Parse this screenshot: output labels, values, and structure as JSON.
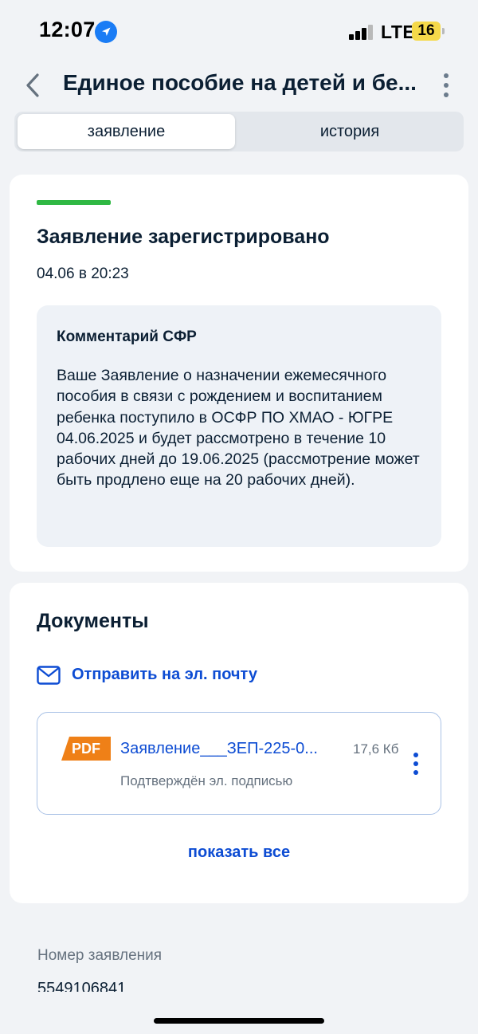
{
  "status_bar": {
    "time": "12:07",
    "network": "LTE",
    "battery": "16",
    "icons": [
      "location-arrow-icon",
      "signal-icon",
      "battery-icon"
    ]
  },
  "header": {
    "title": "Единое пособие на детей и бе...",
    "icons": [
      "chevron-left-icon",
      "more-vertical-icon"
    ]
  },
  "tabs": [
    {
      "label": "заявление",
      "active": true
    },
    {
      "label": "история",
      "active": false
    }
  ],
  "status_card": {
    "title": "Заявление зарегистрировано",
    "date": "04.06 в 20:23",
    "progress_color": "#2fb843",
    "comment": {
      "title": "Комментарий СФР",
      "text": "Ваше Заявление о назначении ежемесячного пособия в связи с рождением и воспитанием ребенка поступило в ОСФР ПО ХМАО - ЮГРЕ 04.06.2025 и будет рассмотрено в течение 10 рабочих дней до 19.06.2025 (рассмотрение может быть продлено еще на 20 рабочих дней)."
    }
  },
  "documents": {
    "title": "Документы",
    "send_email_label": "Отправить на эл. почту",
    "items": [
      {
        "badge": "PDF",
        "name": "Заявление___ЗЕП-225-0...",
        "size": "17,6 Кб",
        "signature": "Подтверждён эл. подписью"
      }
    ],
    "show_all_label": "показать все"
  },
  "application_number": {
    "label": "Номер заявления",
    "value": "5549106841"
  },
  "colors": {
    "accent": "#0d4cd3",
    "pdf_badge": "#ef8017",
    "background": "#f1f3f6"
  }
}
